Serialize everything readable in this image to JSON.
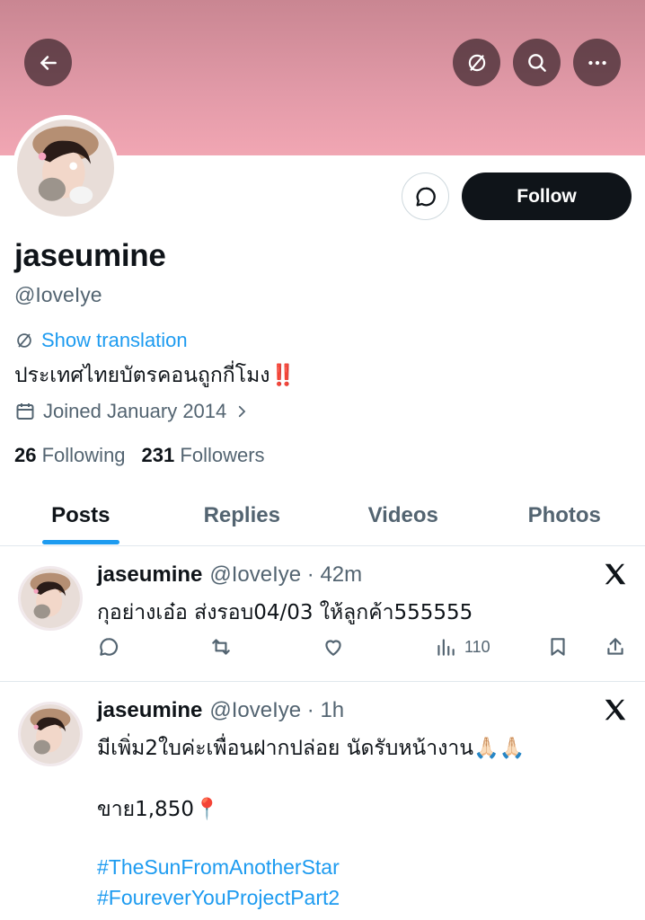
{
  "header": {
    "back_icon": "arrow-left-icon",
    "translate_icon": "translate-icon",
    "search_icon": "search-icon",
    "more_icon": "more-icon"
  },
  "profile": {
    "display_name": "jaseumine",
    "handle": "@IoveIye",
    "follow_label": "Follow",
    "show_translation": "Show translation",
    "bio": "ประเทศไทยบัตรคอนถูกกี่โมง",
    "bio_mark": "‼️",
    "joined": "Joined January 2014",
    "following_count": "26",
    "following_label": "Following",
    "followers_count": "231",
    "followers_label": "Followers"
  },
  "tabs": [
    {
      "label": "Posts",
      "active": true
    },
    {
      "label": "Replies",
      "active": false
    },
    {
      "label": "Videos",
      "active": false
    },
    {
      "label": "Photos",
      "active": false
    }
  ],
  "posts": [
    {
      "name": "jaseumine",
      "meta": "@IoveIye · 42m",
      "text": "กุอย่างเอ๋อ ส่งรอบ04/03 ให้ลูกค้า555555",
      "views": "110"
    },
    {
      "name": "jaseumine",
      "meta": "@IoveIye · 1h",
      "text": "มีเพิ่ม2ใบค่ะเพื่อนฝากปล่อย นัดรับหน้างาน🙏🏻🙏🏻",
      "price": "ขาย1,850📍",
      "hashtag1": "#TheSunFromAnotherStar",
      "hashtag2": "#FoureverYouProjectPart2"
    }
  ],
  "colors": {
    "accent": "#1d9bf0",
    "banner": "#e29aa8",
    "text": "#0f1419",
    "muted": "#536471"
  }
}
